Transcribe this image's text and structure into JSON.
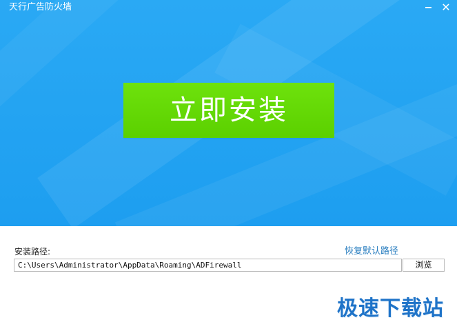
{
  "window": {
    "title": "天行广告防火墙",
    "minimize_icon": "minimize-icon",
    "close_glyph": "✕"
  },
  "banner": {
    "install_label": "立即安装",
    "background_color": "#1d9ef0",
    "button_color": "#5bd000"
  },
  "install_path": {
    "label": "安装路径:",
    "value": "C:\\Users\\Administrator\\AppData\\Roaming\\ADFirewall",
    "restore_default_label": "恢复默认路径",
    "browse_label": "浏览"
  },
  "watermark": {
    "text": "极速下载站"
  }
}
